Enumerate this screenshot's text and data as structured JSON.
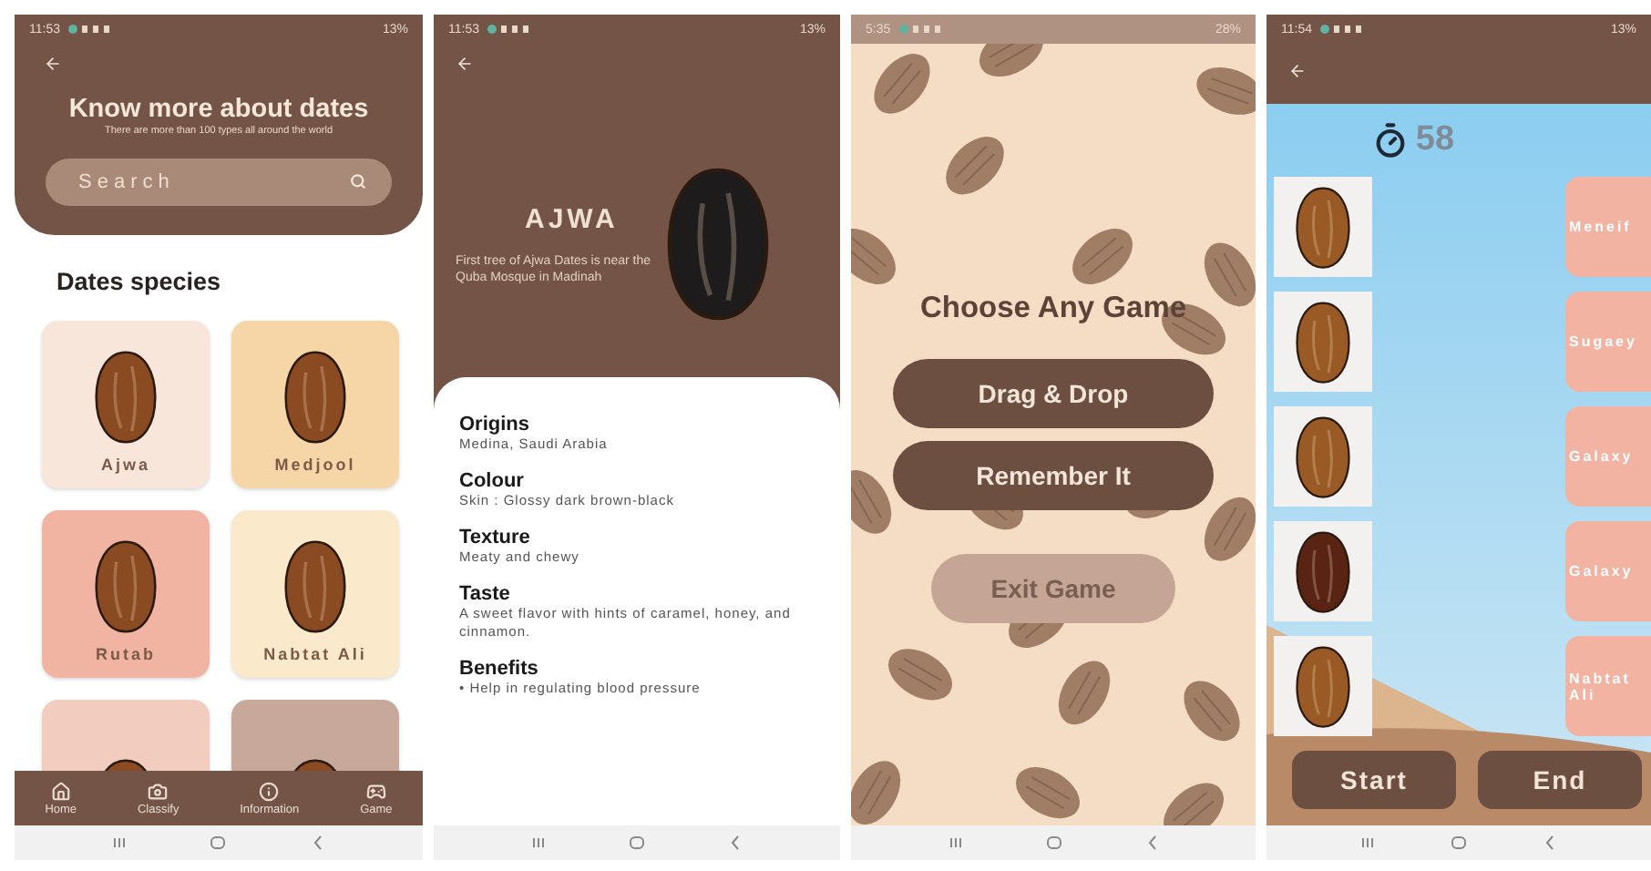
{
  "phones": [
    {
      "kind": "species_list",
      "status_bar": {
        "time": "11:53",
        "battery": "13%"
      },
      "title": "Know more about dates",
      "subtitle": "There are more than 100 types all around the world",
      "search": {
        "placeholder": "Search"
      },
      "section_title": "Dates species",
      "species": [
        {
          "name": "Ajwa",
          "color": "#f9e6da"
        },
        {
          "name": "Medjool",
          "color": "#f6d6a6"
        },
        {
          "name": "Rutab",
          "color": "#f2b4a2"
        },
        {
          "name": "Nabtat Ali",
          "color": "#faeacb"
        },
        {
          "color": "#f2cdbf"
        },
        {
          "color": "#c7a89a"
        }
      ],
      "bottom_nav": [
        {
          "label": "Home"
        },
        {
          "label": "Classify"
        },
        {
          "label": "Information"
        },
        {
          "label": "Game"
        }
      ]
    },
    {
      "kind": "detail",
      "status_bar": {
        "time": "11:53",
        "battery": "13%"
      },
      "title": "AJWA",
      "description": "First tree of Ajwa Dates is near the Quba Mosque in Madinah",
      "sections": [
        {
          "heading": "Origins",
          "body": "Medina, Saudi Arabia"
        },
        {
          "heading": "Colour",
          "body": "Skin : Glossy dark brown-black"
        },
        {
          "heading": "Texture",
          "body": "Meaty and chewy"
        },
        {
          "heading": "Taste",
          "body": "A sweet flavor with hints of caramel, honey, and cinnamon."
        },
        {
          "heading": "Benefits",
          "body": "• Help in regulating blood pressure"
        }
      ]
    },
    {
      "kind": "game_menu",
      "status_bar": {
        "time": "5:35",
        "battery": "28%"
      },
      "title": "Choose Any Game",
      "buttons": [
        {
          "label": "Drag & Drop",
          "primary": true
        },
        {
          "label": "Remember It",
          "primary": true
        },
        {
          "label": "Exit Game",
          "primary": false
        }
      ]
    },
    {
      "kind": "matching_game",
      "status_bar": {
        "time": "11:54",
        "battery": "13%"
      },
      "timer": "58",
      "photos": [
        {
          "kind": "light"
        },
        {
          "kind": "light"
        },
        {
          "kind": "light"
        },
        {
          "kind": "dark"
        },
        {
          "kind": "light"
        }
      ],
      "names": [
        "Meneif",
        "Sugaey",
        "Galaxy",
        "Galaxy",
        "Nabtat Ali"
      ],
      "buttons": [
        "Start",
        "End"
      ]
    }
  ]
}
